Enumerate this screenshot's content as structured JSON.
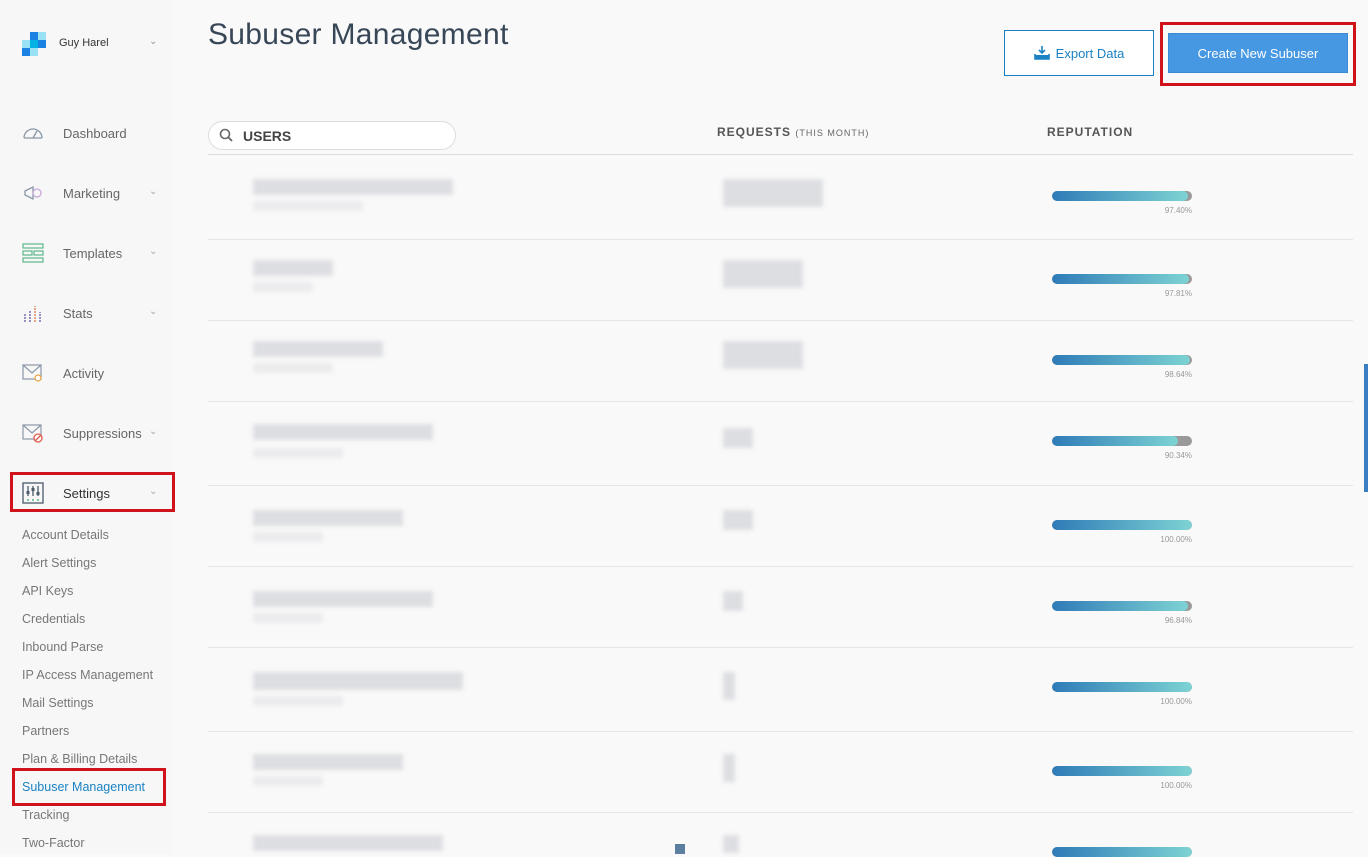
{
  "account": {
    "name": "Guy Harel",
    "chevron_icon": "chevron-down-icon"
  },
  "sidebar": {
    "items": [
      {
        "label": "Dashboard",
        "icon": "dashboard-icon",
        "expandable": false
      },
      {
        "label": "Marketing",
        "icon": "megaphone-icon",
        "expandable": true
      },
      {
        "label": "Templates",
        "icon": "templates-icon",
        "expandable": true
      },
      {
        "label": "Stats",
        "icon": "stats-icon",
        "expandable": true
      },
      {
        "label": "Activity",
        "icon": "activity-icon",
        "expandable": false
      },
      {
        "label": "Suppressions",
        "icon": "suppressions-icon",
        "expandable": true
      },
      {
        "label": "Settings",
        "icon": "settings-icon",
        "expandable": true
      }
    ],
    "settings_items": [
      "Account Details",
      "Alert Settings",
      "API Keys",
      "Credentials",
      "Inbound Parse",
      "IP Access Management",
      "Mail Settings",
      "Partners",
      "Plan & Billing Details",
      "Subuser Management",
      "Tracking",
      "Two-Factor"
    ],
    "active_settings_item": "Subuser Management"
  },
  "main": {
    "title": "Subuser Management",
    "export_label": "Export Data",
    "create_label": "Create New Subuser",
    "search_placeholder": "USERS",
    "col_requests": "REQUESTS",
    "col_requests_sub": "(THIS MONTH)",
    "col_reputation": "REPUTATION"
  },
  "rows": [
    {
      "reputation": "97.40%",
      "rep_value": 97.4
    },
    {
      "reputation": "97.81%",
      "rep_value": 97.81
    },
    {
      "reputation": "98.64%",
      "rep_value": 98.64
    },
    {
      "reputation": "90.34%",
      "rep_value": 90.34
    },
    {
      "reputation": "100.00%",
      "rep_value": 100
    },
    {
      "reputation": "96.84%",
      "rep_value": 96.84
    },
    {
      "reputation": "100.00%",
      "rep_value": 100
    },
    {
      "reputation": "100.00%",
      "rep_value": 100
    },
    {
      "reputation": "",
      "rep_value": 100
    }
  ],
  "colors": {
    "accent": "#1a82c4",
    "primary_button": "#4698e3",
    "highlight": "#d0121b"
  }
}
